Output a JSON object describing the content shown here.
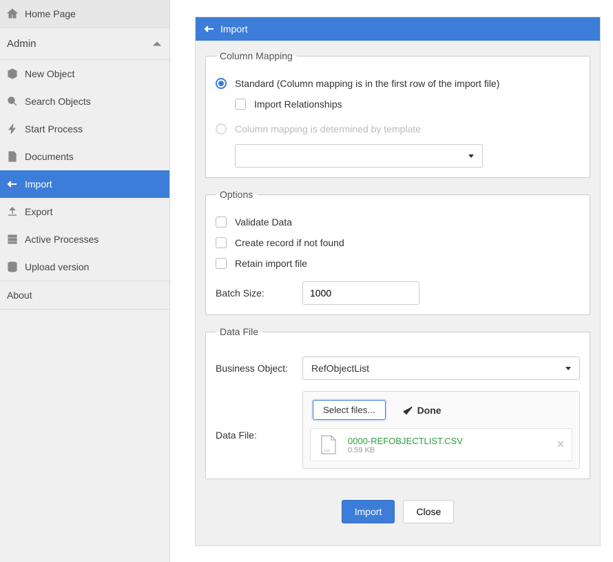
{
  "sidebar": {
    "home_label": "Home Page",
    "section_label": "Admin",
    "items": [
      {
        "label": "New Object"
      },
      {
        "label": "Search Objects"
      },
      {
        "label": "Start Process"
      },
      {
        "label": "Documents"
      },
      {
        "label": "Import"
      },
      {
        "label": "Export"
      },
      {
        "label": "Active Processes"
      },
      {
        "label": "Upload version"
      }
    ],
    "about_label": "About"
  },
  "panel": {
    "title": "Import"
  },
  "column_mapping": {
    "legend": "Column Mapping",
    "standard_label": "Standard (Column mapping is in the first row of the import file)",
    "import_rel_label": "Import Relationships",
    "template_label": "Column mapping is determined by template",
    "template_value": ""
  },
  "options": {
    "legend": "Options",
    "validate_label": "Validate Data",
    "create_label": "Create record if not found",
    "retain_label": "Retain import file",
    "batch_size_label": "Batch Size:",
    "batch_size_value": "1000"
  },
  "data_file": {
    "legend": "Data File",
    "bo_label": "Business Object:",
    "bo_value": "RefObjectList",
    "df_label": "Data File:",
    "select_files_label": "Select files...",
    "done_label": "Done",
    "file_name": "0000-REFOBJECTLIST.CSV",
    "file_size": "0.59 KB"
  },
  "footer": {
    "import_label": "Import",
    "close_label": "Close"
  }
}
